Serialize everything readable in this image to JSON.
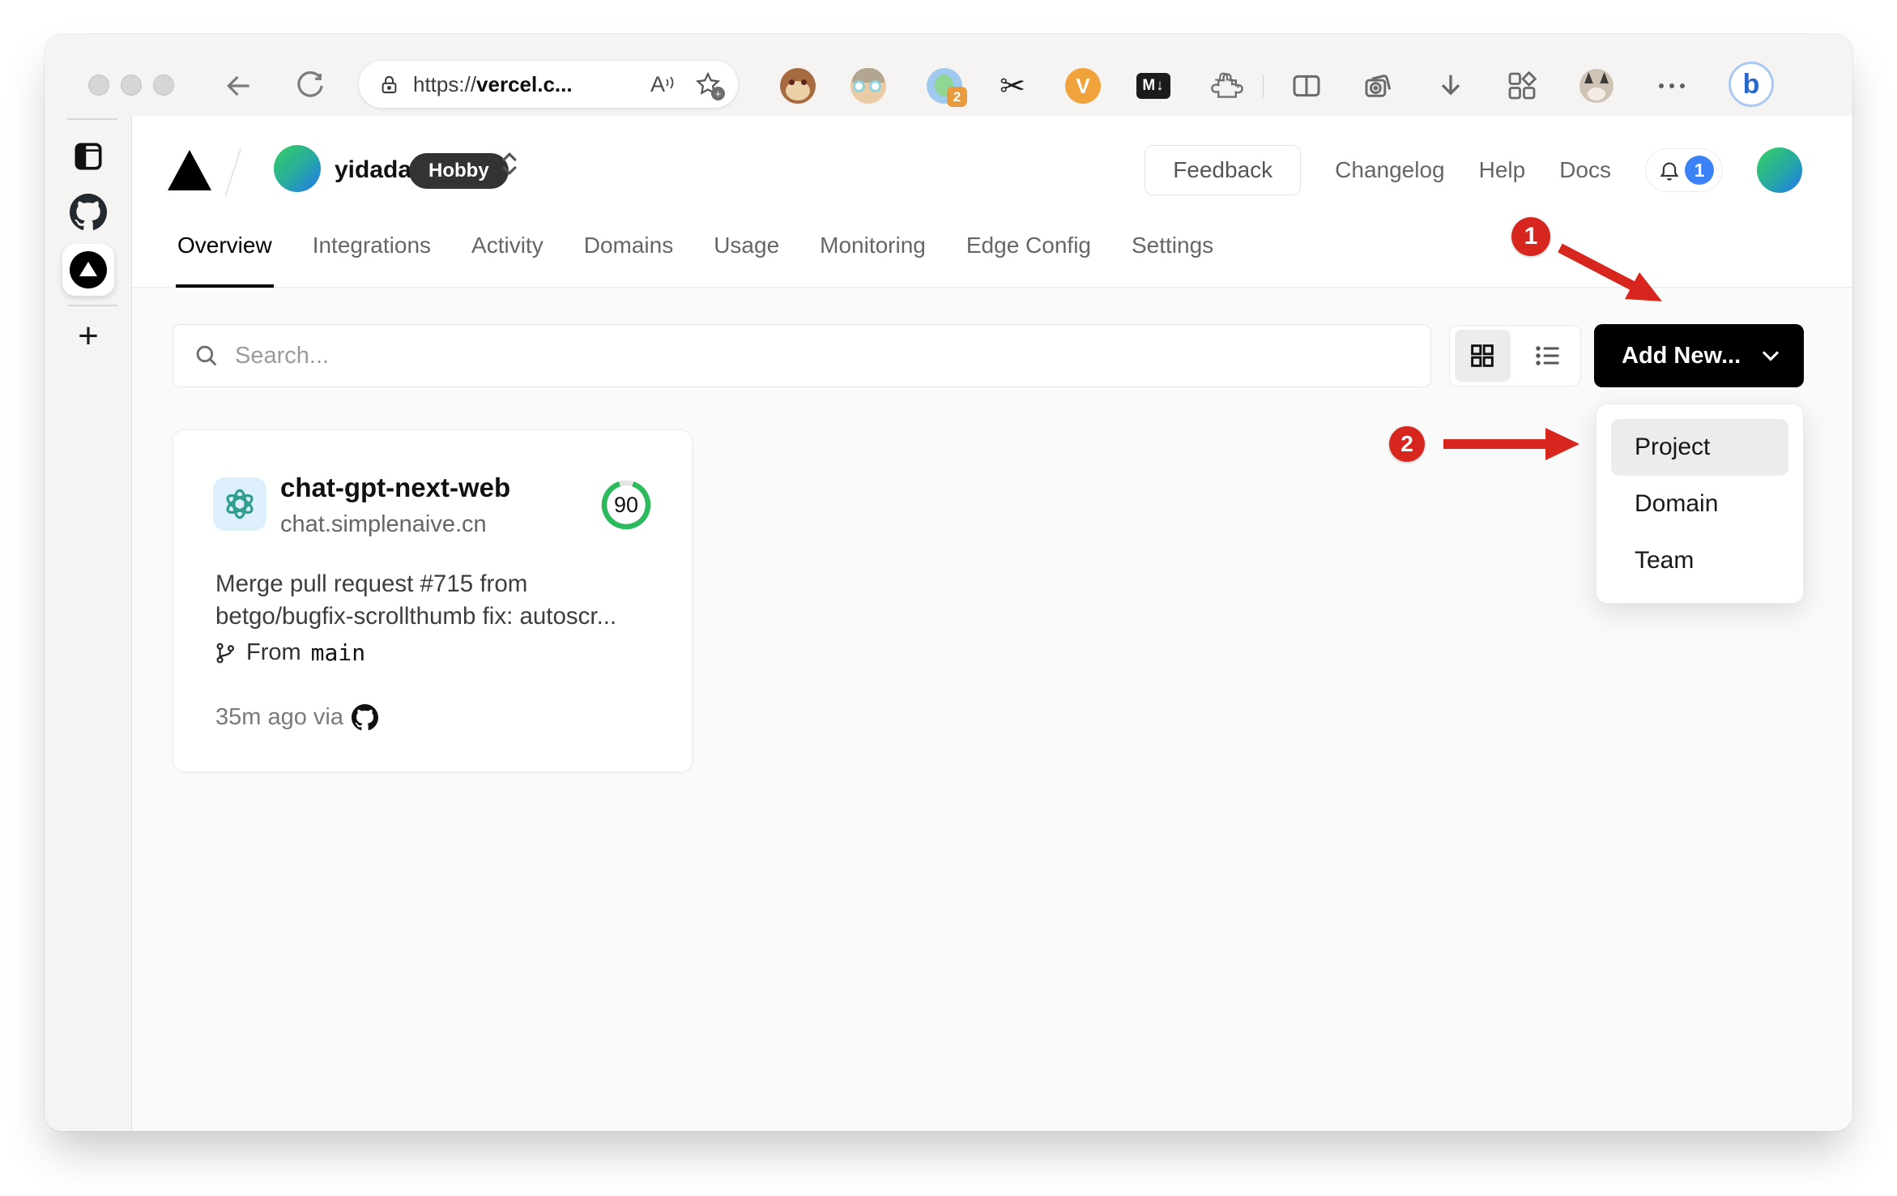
{
  "browser": {
    "url": {
      "prefix": "https://",
      "emphasis": "vercel.c..."
    },
    "extensions": {
      "badge_count": "2",
      "v_label": "V",
      "markdown_label": "M↓"
    },
    "bing_label": "b"
  },
  "header": {
    "team_name": "yidadaa",
    "plan_badge": "Hobby",
    "feedback_label": "Feedback",
    "links": [
      "Changelog",
      "Help",
      "Docs"
    ],
    "notification_count": "1"
  },
  "tabs": [
    "Overview",
    "Integrations",
    "Activity",
    "Domains",
    "Usage",
    "Monitoring",
    "Edge Config",
    "Settings"
  ],
  "controls": {
    "search_placeholder": "Search...",
    "add_new_label": "Add New..."
  },
  "project_card": {
    "name": "chat-gpt-next-web",
    "domain": "chat.simplenaive.cn",
    "score": "90",
    "commit_line1": "Merge pull request #715 from",
    "commit_line2": "betgo/bugfix-scrollthumb fix: autoscr...",
    "branch_label": "From",
    "branch_name": "main",
    "deploy_meta": "35m ago via"
  },
  "dropdown": {
    "items": [
      "Project",
      "Domain",
      "Team"
    ]
  },
  "annotations": {
    "step1": "1",
    "step2": "2"
  },
  "colors": {
    "score_green": "#2dba5d",
    "accent_blue": "#3b82f6",
    "annotation_red": "#d7261d"
  }
}
